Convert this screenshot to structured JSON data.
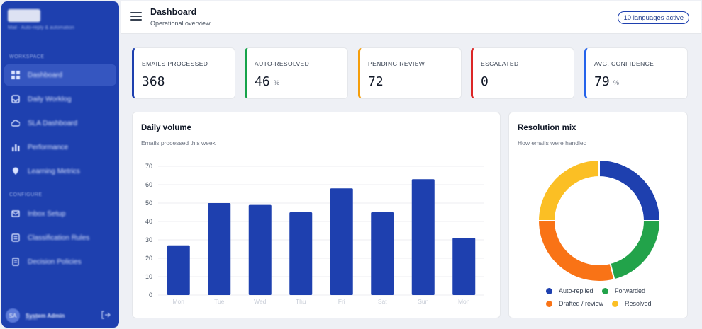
{
  "sidebar": {
    "logo": "BAGE",
    "logo_sub": "Mail · Auto-reply & automation",
    "section_main": "WORKSPACE",
    "section_config": "CONFIGURE",
    "items": [
      {
        "label": "Dashboard",
        "icon": "grid-icon"
      },
      {
        "label": "Daily Worklog",
        "icon": "inbox-icon"
      },
      {
        "label": "SLA Dashboard",
        "icon": "cloud-icon"
      },
      {
        "label": "Performance",
        "icon": "bar-chart-icon"
      },
      {
        "label": "Learning Metrics",
        "icon": "pin-icon"
      },
      {
        "label": "Inbox Setup",
        "icon": "mail-icon"
      },
      {
        "label": "Classification Rules",
        "icon": "list-icon"
      },
      {
        "label": "Decision Policies",
        "icon": "doc-icon"
      }
    ],
    "user": {
      "initials": "SA",
      "name": "System Admin",
      "role": "Admin"
    }
  },
  "header": {
    "title": "Dashboard",
    "subtitle": "Operational overview",
    "badge": "10 languages active"
  },
  "stats": [
    {
      "label": "EMAILS PROCESSED",
      "value": "368",
      "unit": "",
      "color": "#1e40af"
    },
    {
      "label": "AUTO-RESOLVED",
      "value": "46",
      "unit": "%",
      "color": "#16a34a"
    },
    {
      "label": "PENDING REVIEW",
      "value": "72",
      "unit": "",
      "color": "#f59e0b"
    },
    {
      "label": "ESCALATED",
      "value": "0",
      "unit": "",
      "color": "#dc2626"
    },
    {
      "label": "AVG. CONFIDENCE",
      "value": "79",
      "unit": "%",
      "color": "#2563eb"
    }
  ],
  "volume": {
    "title": "Daily volume",
    "subtitle": "Emails processed this week"
  },
  "mix": {
    "title": "Resolution mix",
    "subtitle": "How emails were handled"
  },
  "chart_data": [
    {
      "type": "bar",
      "title": "Daily volume",
      "subtitle": "Emails processed this week",
      "categories": [
        "Mon",
        "Tue",
        "Wed",
        "Thu",
        "Fri",
        "Sat",
        "Sun",
        "Mon"
      ],
      "values": [
        27,
        50,
        49,
        45,
        58,
        45,
        63,
        31
      ],
      "ylim": [
        0,
        70
      ],
      "yticks": [
        0,
        10,
        20,
        30,
        40,
        50,
        60,
        70
      ],
      "color": "#1e40af",
      "grid": true
    },
    {
      "type": "pie",
      "title": "Resolution mix",
      "subtitle": "How emails were handled",
      "labels": [
        "Auto-replied",
        "Forwarded",
        "Drafted / review",
        "Resolved"
      ],
      "values": [
        25,
        21,
        29,
        25
      ],
      "colors": [
        "#1e40af",
        "#22a34a",
        "#f97316",
        "#fbbf24"
      ],
      "donut": true,
      "legend": "bottom"
    }
  ]
}
